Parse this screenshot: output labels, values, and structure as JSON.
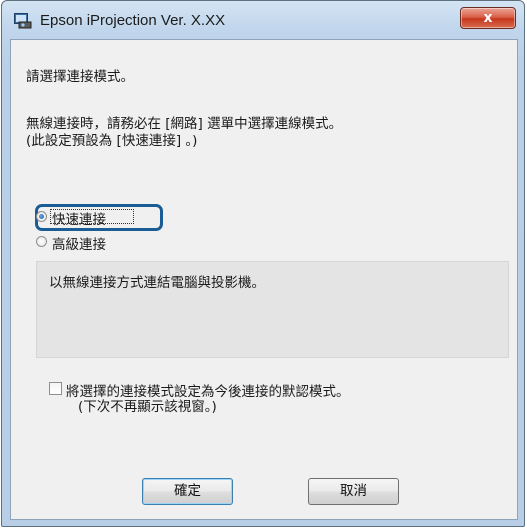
{
  "window": {
    "title": "Epson iProjection Ver. X.XX",
    "close_label": "x"
  },
  "dialog": {
    "instruction": "請選擇連接模式。",
    "note_line1": "無線連接時，請務必在 [網路] 選單中選擇連線模式。",
    "note_line2": "(此設定預設為 [快速連接] 。)",
    "modes": [
      {
        "label": "快速連接",
        "selected": true
      },
      {
        "label": "高級連接",
        "selected": false
      }
    ],
    "description": "以無線連接方式連結電腦與投影機。",
    "default_checkbox": {
      "line1": "將選擇的連接模式設定為今後連接的默認模式。",
      "line2": "(下次不再顯示該視窗。)",
      "checked": false
    },
    "ok_label": "確定",
    "cancel_label": "取消"
  },
  "colors": {
    "focus_ring": "#1a5d96",
    "close_button": "#c7371d"
  },
  "icons": {
    "app": "projector-app-icon",
    "close": "close-icon",
    "radio_selected": "radio-selected-icon",
    "radio_unselected": "radio-unselected-icon"
  }
}
